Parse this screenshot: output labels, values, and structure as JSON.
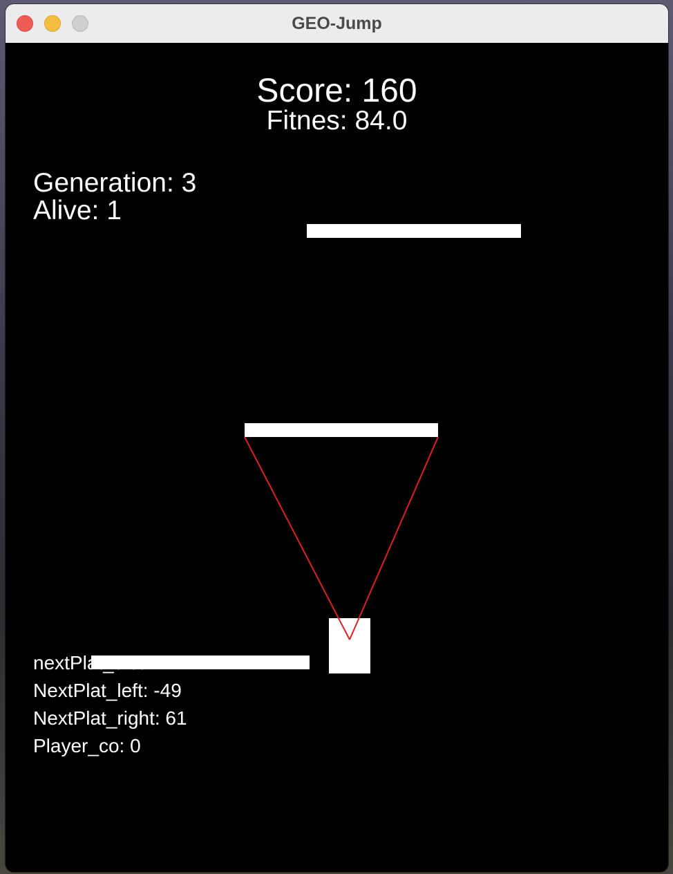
{
  "window": {
    "title": "GEO-Jump"
  },
  "hud": {
    "score": "Score: 160",
    "fitness": "Fitnes: 84.0",
    "generation": "Generation: 3",
    "alive": "Alive: 1"
  },
  "debug": {
    "next_plat_dist": "nextPlat_dist: 177",
    "next_plat_left": "NextPlat_left: -49",
    "next_plat_right": "NextPlat_right: 61",
    "player_co": "Player_co: 0"
  },
  "colors": {
    "background": "#000000",
    "platform": "#ffffff",
    "player": "#ffffff",
    "sensor_line": "#e02020",
    "close_button": "#ee5c55",
    "minimize_button": "#f5be3e",
    "zoom_button": "#cfcfcf"
  }
}
